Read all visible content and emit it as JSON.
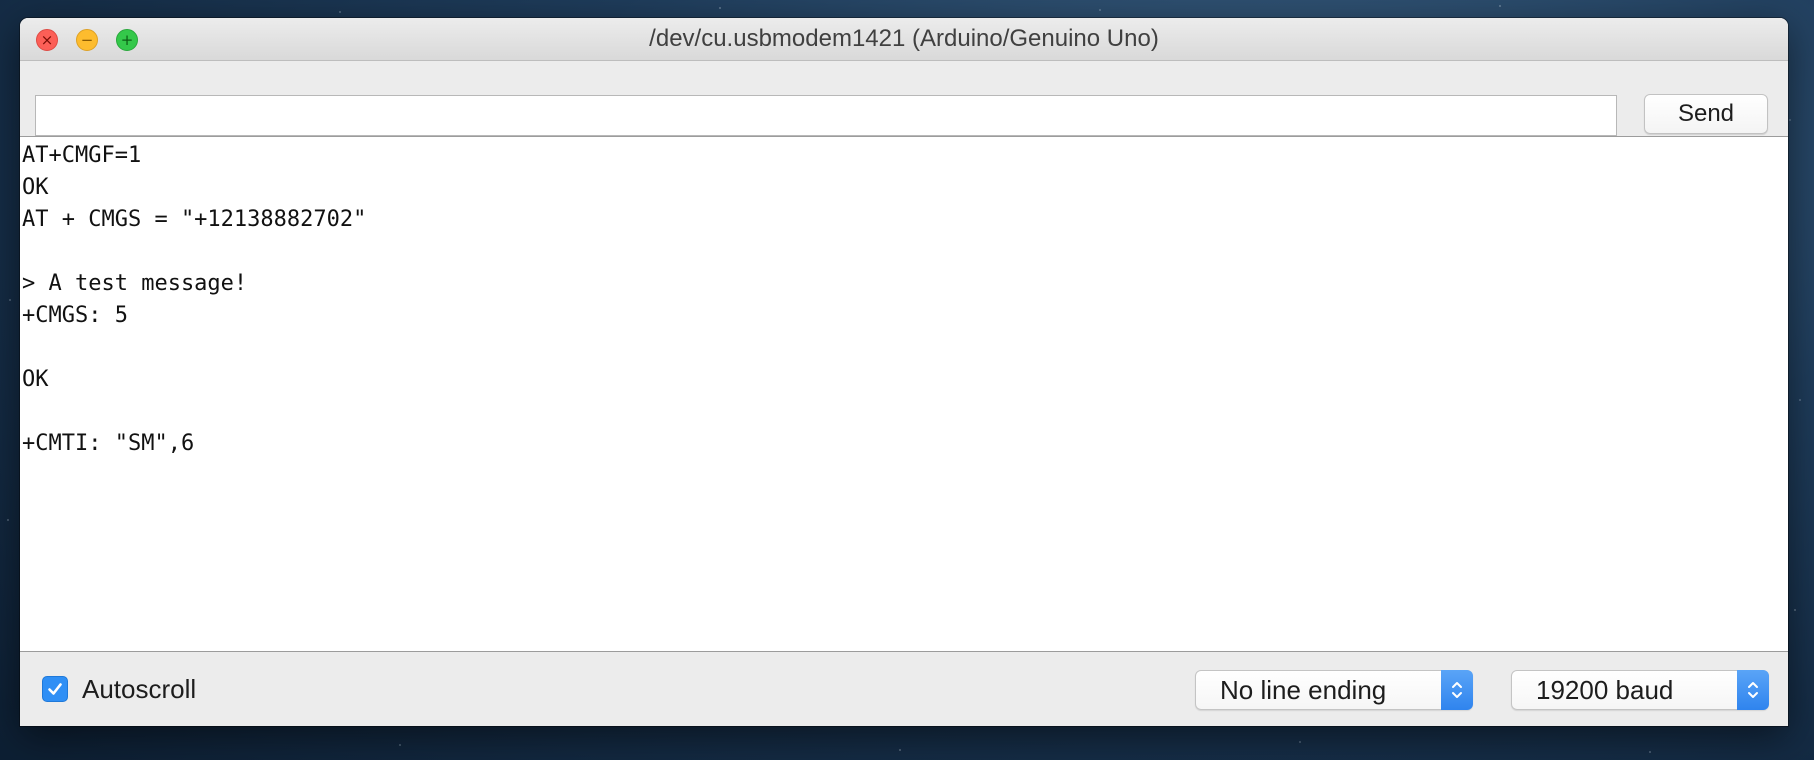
{
  "window": {
    "title": "/dev/cu.usbmodem1421 (Arduino/Genuino Uno)"
  },
  "toolbar": {
    "input_value": "",
    "send_label": "Send"
  },
  "output": {
    "lines": [
      "AT+CMGF=1",
      "OK",
      "AT + CMGS = \"+12138882702\"",
      "",
      "> A test message!",
      "+CMGS: 5",
      "",
      "OK",
      "",
      "+CMTI: \"SM\",6"
    ]
  },
  "statusbar": {
    "autoscroll_label": "Autoscroll",
    "autoscroll_checked": true,
    "line_ending": "No line ending",
    "baud_rate": "19200 baud"
  },
  "colors": {
    "accent": "#2f8ff5",
    "close": "#fc5f57",
    "minimize": "#fdbc2e",
    "maximize": "#34c84a"
  },
  "icons": {
    "close": "close-icon",
    "minimize": "minimize-icon",
    "maximize": "maximize-icon",
    "checkbox": "checkmark-icon",
    "select": "updown-chevron-icon"
  }
}
